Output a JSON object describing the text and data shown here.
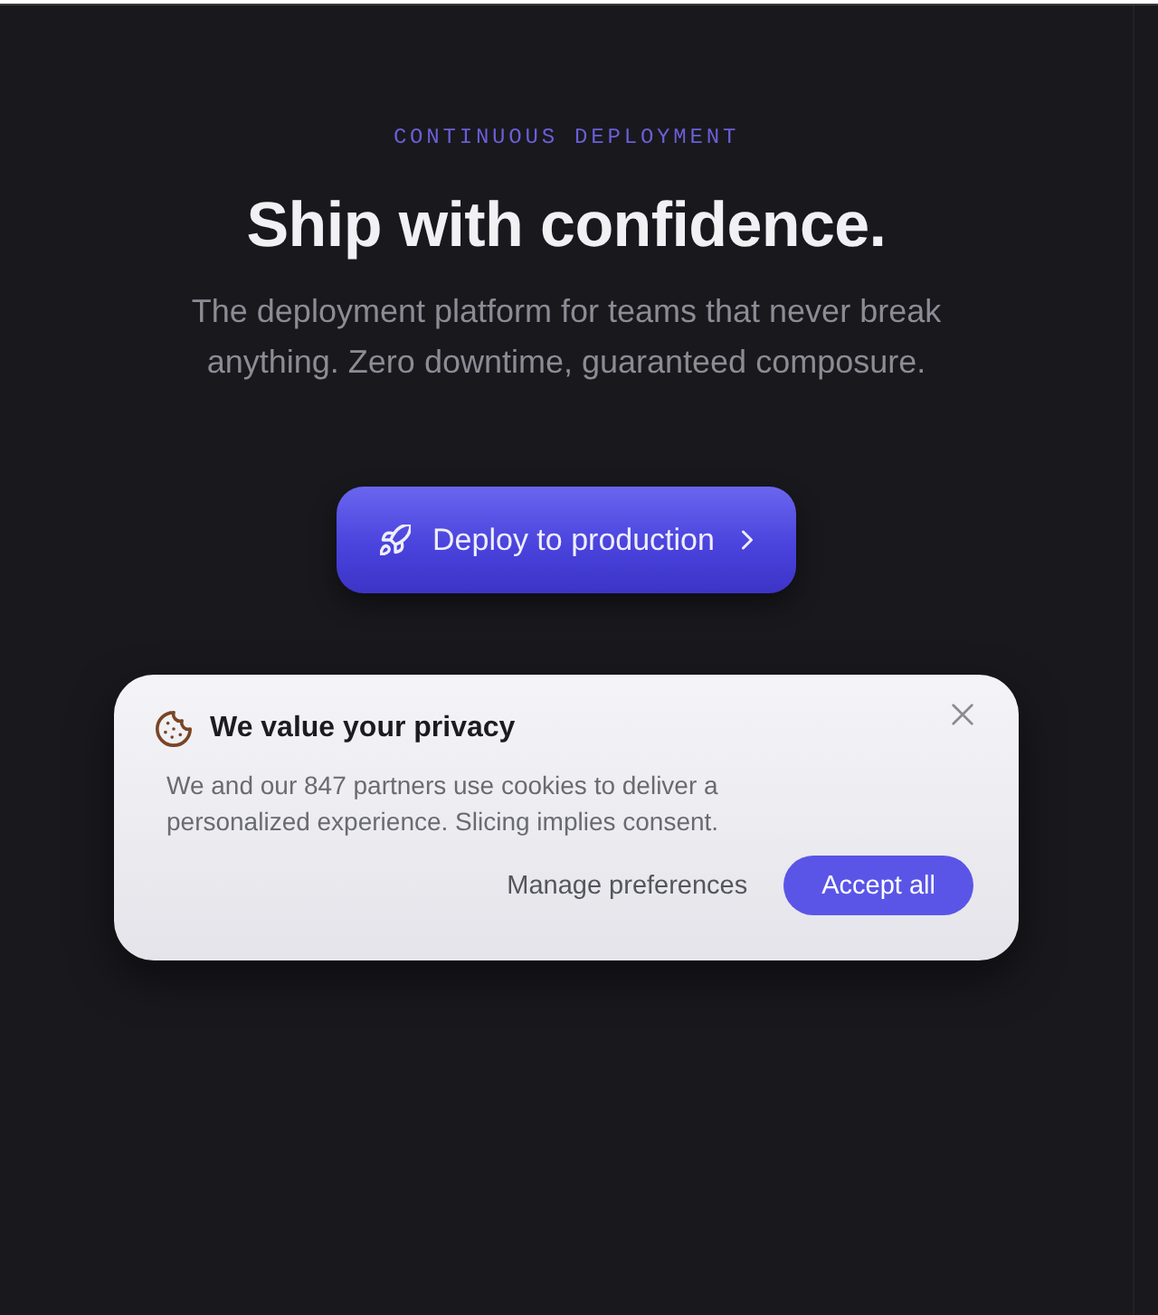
{
  "hero": {
    "eyebrow": "CONTINUOUS DEPLOYMENT",
    "title": "Ship with confidence.",
    "subtitle": "The deployment platform for teams that never break anything. Zero downtime, guaranteed composure.",
    "cta": {
      "label": "Deploy to production"
    }
  },
  "cookie_banner": {
    "title": "We value your privacy",
    "body": "We and our 847 partners use cookies to deliver a personalized experience. Slicing implies consent.",
    "buttons": [
      {
        "label": "Manage preferences",
        "kind": "secondary"
      },
      {
        "label": "Accept all",
        "kind": "primary"
      }
    ]
  }
}
